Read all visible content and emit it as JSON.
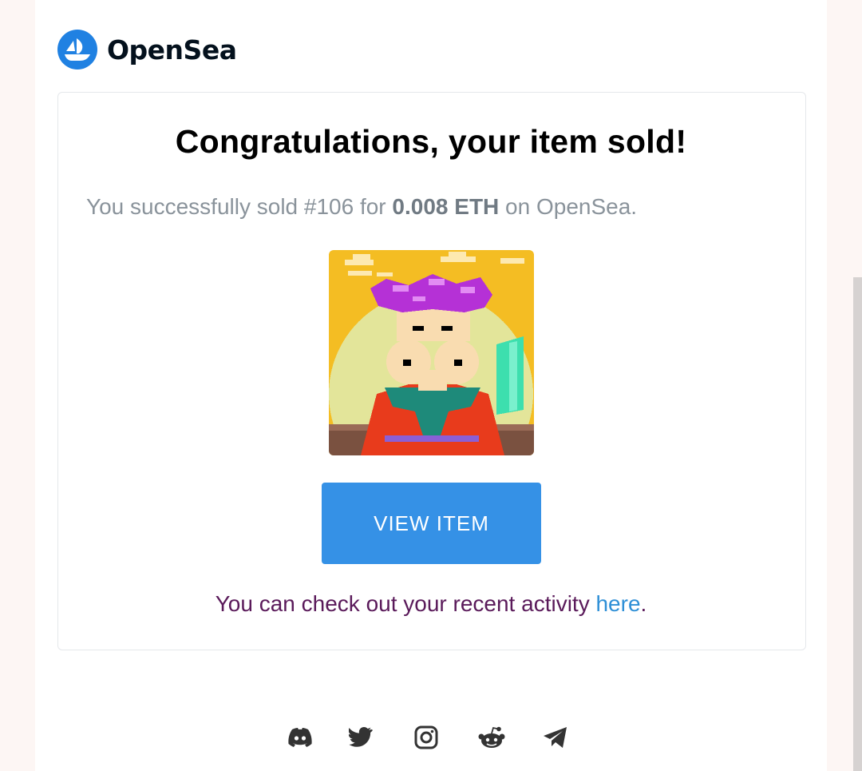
{
  "brand": {
    "name": "OpenSea",
    "color": "#2081e2"
  },
  "card": {
    "title": "Congratulations, your item sold!",
    "sold_prefix": "You successfully sold #106 for ",
    "sold_price": "0.008 ETH",
    "sold_suffix": " on OpenSea.",
    "view_button": "VIEW ITEM",
    "activity_text": "You can check out your recent activity ",
    "activity_link": "here",
    "activity_end": "."
  },
  "socials": [
    "discord-icon",
    "twitter-icon",
    "instagram-icon",
    "reddit-icon",
    "telegram-icon"
  ]
}
